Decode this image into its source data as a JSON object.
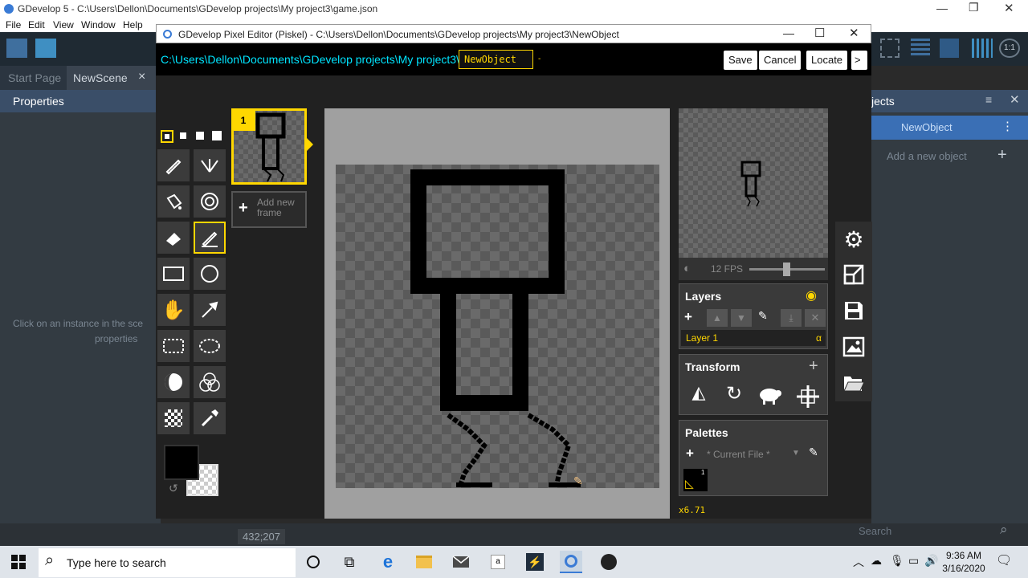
{
  "background_app": {
    "title": "GDevelop 5 - C:\\Users\\Dellon\\Documents\\GDevelop projects\\My project3\\game.json",
    "menu": [
      "File",
      "Edit",
      "View",
      "Window",
      "Help"
    ],
    "tabs": [
      {
        "label": "Start Page"
      },
      {
        "label": "NewScene"
      }
    ],
    "tab_close": "×",
    "properties_title": "Properties",
    "properties_hint_line1": "Click on an instance in the sce",
    "properties_hint_line2": "properties",
    "objects_title": "jects",
    "object_item": "NewObject",
    "add_object": "Add a new object",
    "search_placeholder": "Search",
    "coordinates": "432;207"
  },
  "piskel": {
    "window_title": "GDevelop Pixel Editor (Piskel) - C:\\Users\\Dellon\\Documents\\GDevelop projects\\My project3\\NewObject",
    "path": "C:\\Users\\Dellon\\Documents\\GDevelop projects\\My project3\\",
    "name_field_value": "NewObject",
    "buttons": {
      "save": "Save",
      "cancel": "Cancel",
      "locate": "Locate",
      "more": ">"
    },
    "frame_number": "1",
    "add_frame_label": "Add new frame",
    "fps_label": "12 FPS",
    "fps_value": 12,
    "layers": {
      "title": "Layers",
      "items": [
        "Layer 1"
      ],
      "alpha_symbol": "α"
    },
    "transform": {
      "title": "Transform"
    },
    "palettes": {
      "title": "Palettes",
      "current": "* Current File *",
      "swatch_count": "1"
    },
    "zoom": "x6.71",
    "colors": {
      "primary": "#000000",
      "accent": "#ffd700",
      "path_text": "#00e5ff"
    }
  },
  "taskbar": {
    "search_placeholder": "Type here to search",
    "time": "9:36 AM",
    "date": "3/16/2020",
    "store_label": "a"
  }
}
